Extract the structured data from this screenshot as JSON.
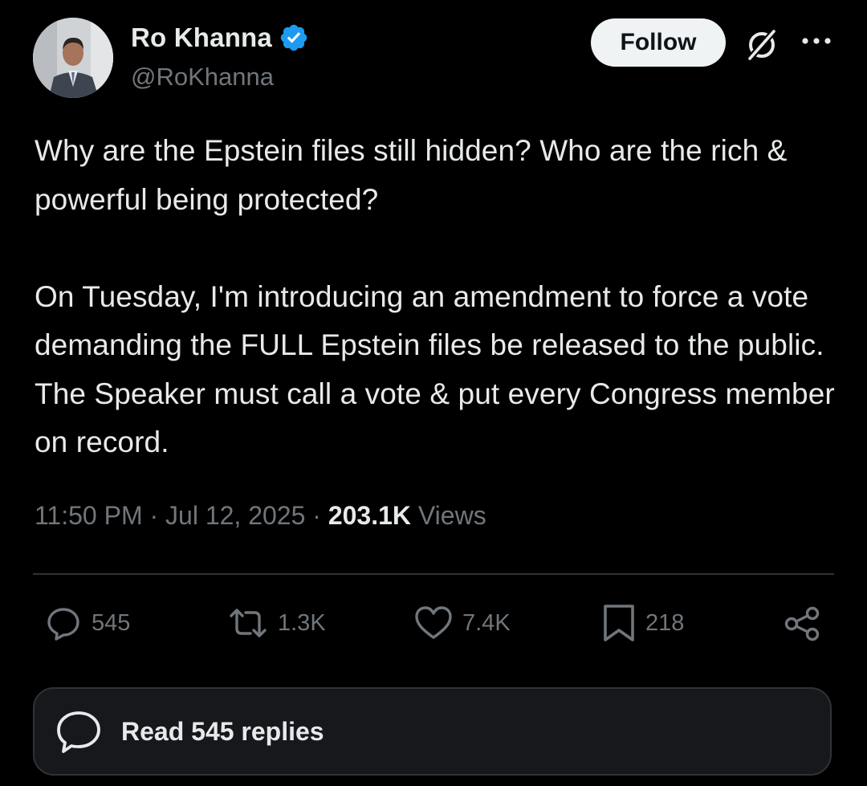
{
  "author": {
    "display_name": "Ro Khanna",
    "handle": "@RoKhanna",
    "verified": true,
    "avatar": "profile-photo"
  },
  "header": {
    "follow_label": "Follow",
    "icons": [
      "grok-icon",
      "more-icon"
    ]
  },
  "tweet": {
    "text": "Why are the Epstein files still hidden? Who are the rich & powerful being protected?\n\nOn Tuesday, I'm introducing an amendment to force a vote demanding the FULL Epstein files be released to the public. The Speaker must call a vote & put every Congress member on record.",
    "time": "11:50 PM",
    "date": "Jul 12, 2025",
    "views_count": "203.1K",
    "views_label": "Views"
  },
  "stats": {
    "replies": "545",
    "reposts": "1.3K",
    "likes": "7.4K",
    "bookmarks": "218"
  },
  "read_replies_label": "Read 545 replies",
  "colors": {
    "background": "#000000",
    "text_primary": "#e7e9ea",
    "text_secondary": "#71767b",
    "verified_blue": "#1d9bf0",
    "divider": "#2f3336"
  }
}
